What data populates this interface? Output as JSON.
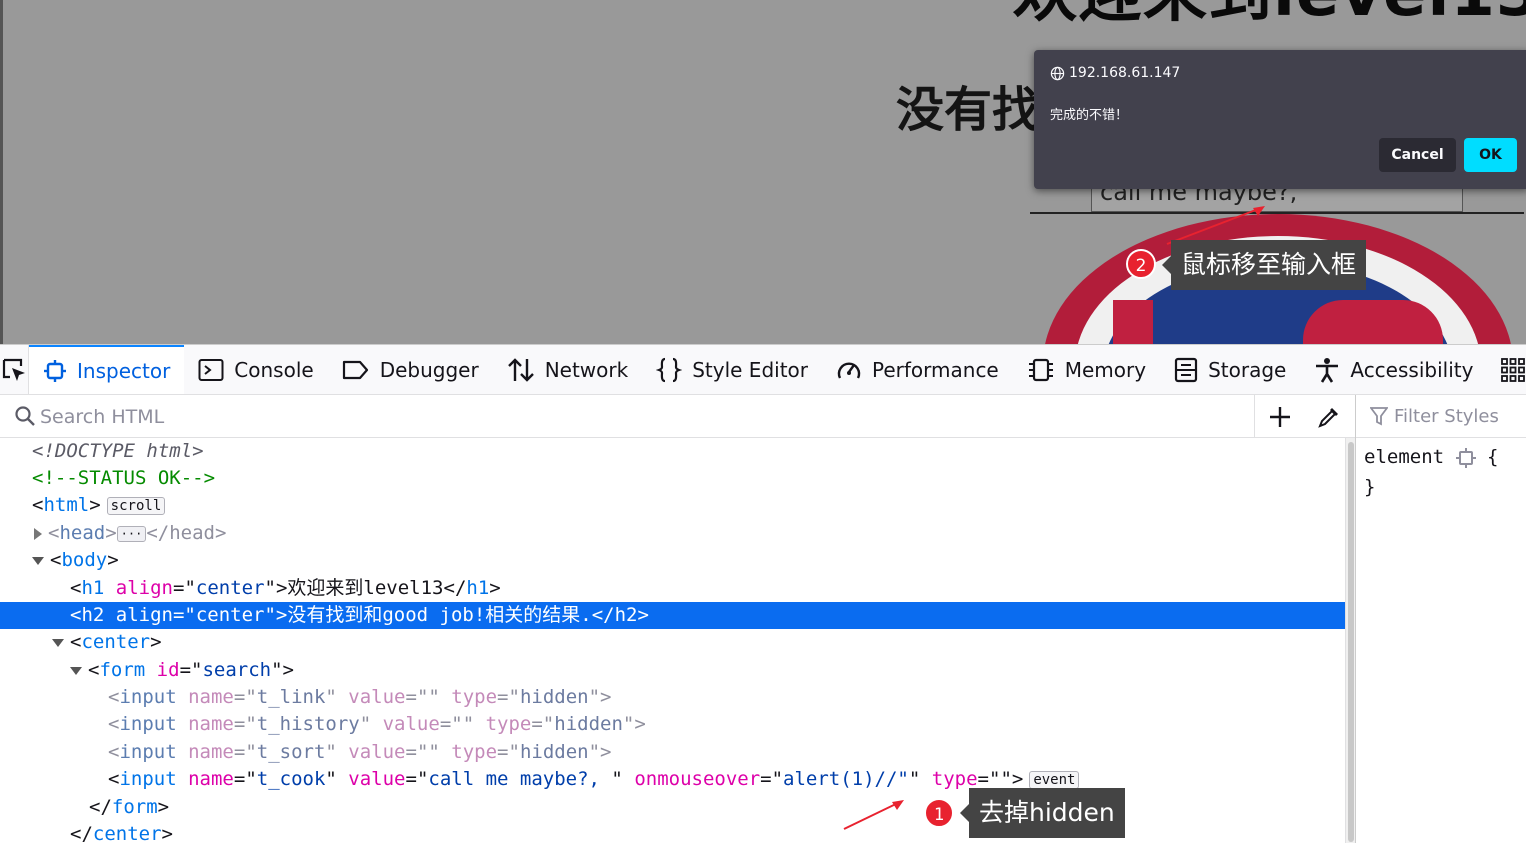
{
  "page": {
    "h1_text": "欢迎来到level13",
    "h2_text": "没有找",
    "input_value": "call me maybe?,"
  },
  "alert": {
    "origin": "192.168.61.147",
    "message": "完成的不错！",
    "cancel_label": "Cancel",
    "ok_label": "OK"
  },
  "annotations": {
    "step2_number": "2",
    "step2_text": "鼠标移至输入框",
    "step1_number": "1",
    "step1_text": "去掉hidden"
  },
  "toolbar": {
    "tabs": [
      {
        "label": "Inspector",
        "icon": "inspector-icon",
        "active": true
      },
      {
        "label": "Console",
        "icon": "console-icon"
      },
      {
        "label": "Debugger",
        "icon": "debugger-icon"
      },
      {
        "label": "Network",
        "icon": "network-icon"
      },
      {
        "label": "Style Editor",
        "icon": "style-editor-icon"
      },
      {
        "label": "Performance",
        "icon": "performance-icon"
      },
      {
        "label": "Memory",
        "icon": "memory-icon"
      },
      {
        "label": "Storage",
        "icon": "storage-icon"
      },
      {
        "label": "Accessibility",
        "icon": "accessibility-icon"
      },
      {
        "label": "Ap",
        "icon": "application-icon"
      }
    ]
  },
  "search": {
    "placeholder": "Search HTML"
  },
  "rules": {
    "filter_placeholder": "Filter Styles",
    "selector": "element",
    "open_brace": "{",
    "close_brace": "}"
  },
  "markup": {
    "doctype": "<!DOCTYPE html>",
    "comment": "<!--STATUS OK-->",
    "html_tag": "html",
    "scroll_badge": "scroll",
    "head_tag": "head",
    "head_close": "</head>",
    "body_tag": "body",
    "h1_attr": "align",
    "h1_attr_val": "center",
    "h1_text": "欢迎来到level13",
    "h2_line": "<h2 align=\"center\">没有找到和good job!相关的结果.</h2>",
    "center_tag": "center",
    "form_attr": "id",
    "form_attr_val": "search",
    "inputs": [
      {
        "name": "t_link",
        "value": "",
        "type": "hidden"
      },
      {
        "name": "t_history",
        "value": "",
        "type": "hidden"
      },
      {
        "name": "t_sort",
        "value": "",
        "type": "hidden"
      }
    ],
    "cook_name": "t_cook",
    "cook_value": "call me maybe?, ",
    "cook_onmouseover": "alert(1)//\"",
    "cook_type": "",
    "event_badge": "event",
    "form_close": "form",
    "center_close": "center"
  }
}
